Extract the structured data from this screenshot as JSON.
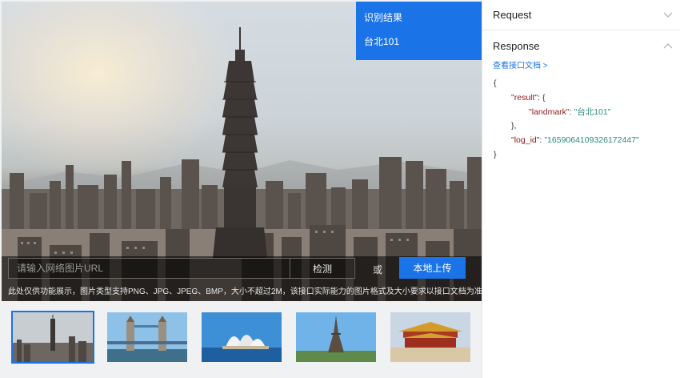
{
  "result": {
    "title": "识别结果",
    "value": "台北101"
  },
  "input": {
    "placeholder": "请输入网络图片URL",
    "detect_label": "检测",
    "or_label": "或",
    "upload_label": "本地上传",
    "hint": "此处仅供功能展示，图片类型支持PNG、JPG、JPEG、BMP，大小不超过2M，该接口实际能力的图片格式及大小要求以接口文档为准"
  },
  "thumbnails": [
    {
      "name": "台北101",
      "selected": true
    },
    {
      "name": "Tower Bridge",
      "selected": false
    },
    {
      "name": "Sydney Opera House",
      "selected": false
    },
    {
      "name": "Eiffel Tower",
      "selected": false
    },
    {
      "name": "Forbidden City",
      "selected": false
    }
  ],
  "side": {
    "request_label": "Request",
    "response_label": "Response",
    "doc_link": "查看接口文档 >",
    "code": {
      "open": "{",
      "result_key": "\"result\"",
      "result_open": ": {",
      "landmark_key": "\"landmark\"",
      "landmark_val": "\"台北101\"",
      "inner_close": "},",
      "log_key": "\"log_id\"",
      "log_val": "\"1659064109326172447\"",
      "close": "}",
      "colon": ": "
    }
  },
  "colors": {
    "accent": "#1b73e8",
    "json_key": "#8b1a1a",
    "json_string": "#2a8a7a"
  }
}
